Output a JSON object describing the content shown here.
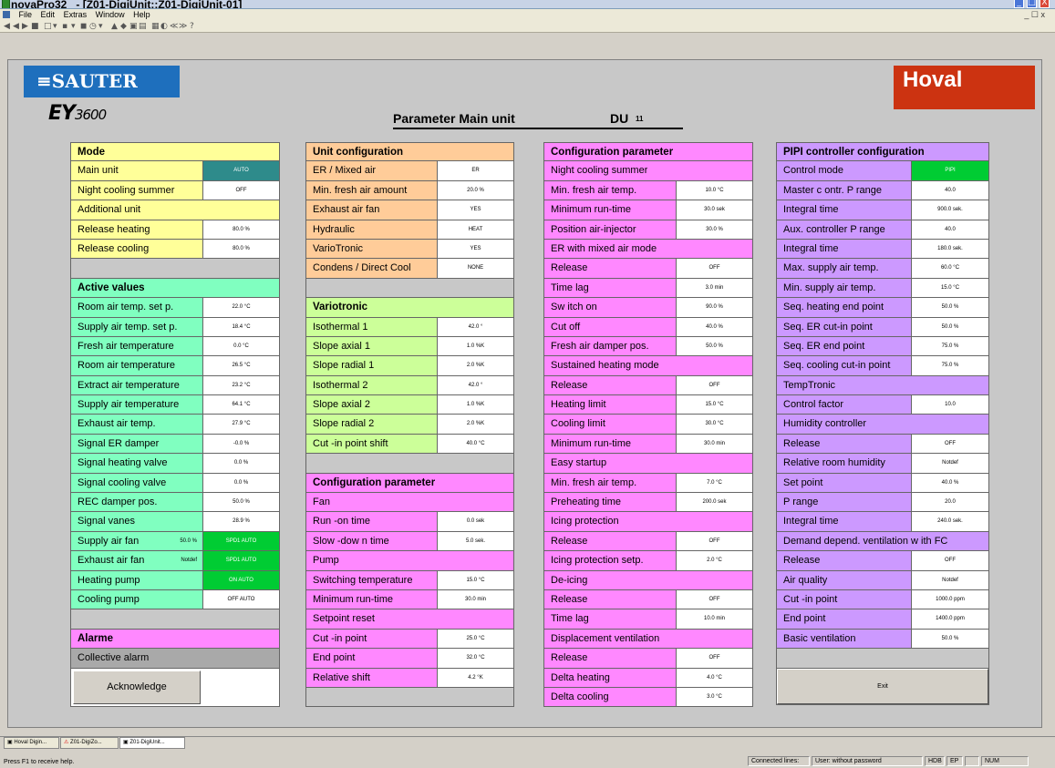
{
  "window": {
    "app_name": "novaPro32",
    "doc_title": "- [Z01-DigiUnit::Z01-DigiUnit-01]",
    "controls": [
      "_",
      "□",
      "X"
    ]
  },
  "menu": [
    "File",
    "Edit",
    "Extras",
    "Window",
    "Help"
  ],
  "mdi_controls": "_ ☐ x",
  "toolbar_glyphs": [
    "◀",
    "◀",
    "▶",
    "■",
    "□",
    "▾",
    "▪",
    "▾",
    "◼",
    "◷",
    "▾",
    "▲",
    "◆",
    "▣",
    "▤",
    "▦",
    "◐",
    "≪",
    "≫",
    "?"
  ],
  "header": {
    "brand_left": "SAUTER",
    "product": "EY",
    "product_suffix": "3600",
    "title": "Parameter Main unit",
    "du_label": "DU",
    "du_number": "11",
    "brand_right": "Hoval"
  },
  "colors": {
    "yellow": "#ffff99",
    "green": "#80ffc0",
    "orange": "#ffcc99",
    "lime": "#ccff99",
    "pink": "#ff88ff",
    "purple": "#cc99ff",
    "gray": "#a9a9a9",
    "teal_status": "#2e8b8b",
    "green_status": "#00cc33"
  },
  "col1": [
    {
      "kind": "header",
      "label": "Mode",
      "bg": "yellow"
    },
    {
      "kind": "item",
      "label": "Main unit",
      "value": "AUTO",
      "bg": "yellow",
      "valbg": "teal_status",
      "valcolor": "#ffffff"
    },
    {
      "kind": "item",
      "label": "Night cooling summer",
      "value": "OFF",
      "bg": "yellow"
    },
    {
      "kind": "section",
      "label": "Additional unit",
      "bg": "yellow"
    },
    {
      "kind": "item",
      "label": "Release heating",
      "value": "80.0 %",
      "bg": "yellow"
    },
    {
      "kind": "item",
      "label": "Release cooling",
      "value": "80.0 %",
      "bg": "yellow"
    },
    {
      "kind": "gap"
    },
    {
      "kind": "header",
      "label": "Active values",
      "bg": "green"
    },
    {
      "kind": "item",
      "label": "Room air temp. set p.",
      "value": "22.0 °C",
      "bg": "green"
    },
    {
      "kind": "item",
      "label": "Supply air temp. set p.",
      "value": "18.4 °C",
      "bg": "green"
    },
    {
      "kind": "item",
      "label": "Fresh air temperature",
      "value": "0.0 °C",
      "bg": "green"
    },
    {
      "kind": "item",
      "label": "Room air temperature",
      "value": "26.5 °C",
      "bg": "green"
    },
    {
      "kind": "item",
      "label": "Extract air temperature",
      "value": "23.2 °C",
      "bg": "green"
    },
    {
      "kind": "item",
      "label": "Supply air temperature",
      "value": "64.1 °C",
      "bg": "green"
    },
    {
      "kind": "item",
      "label": "Exhaust air temp.",
      "value": "27.9 °C",
      "bg": "green"
    },
    {
      "kind": "item",
      "label": "Signal ER damper",
      "value": "-0.0 %",
      "bg": "green"
    },
    {
      "kind": "item",
      "label": "Signal heating valve",
      "value": "0.0 %",
      "bg": "green"
    },
    {
      "kind": "item",
      "label": "Signal cooling valve",
      "value": "0.0 %",
      "bg": "green"
    },
    {
      "kind": "item",
      "label": "REC damper pos.",
      "value": "50.0 %",
      "bg": "green"
    },
    {
      "kind": "item",
      "label": "Signal vanes",
      "value": "28.9 %",
      "bg": "green"
    },
    {
      "kind": "item",
      "label": "Supply air fan",
      "sub": "50.0 %",
      "value": "SPD1 AUTO",
      "bg": "green",
      "valbg": "green_status",
      "valcolor": "#ffffff"
    },
    {
      "kind": "item",
      "label": "Exhaust air fan",
      "sub": "Notdef",
      "value": "SPD1 AUTO",
      "bg": "green",
      "valbg": "green_status",
      "valcolor": "#ffffff"
    },
    {
      "kind": "item",
      "label": "Heating pump",
      "value": "ON AUTO",
      "bg": "green",
      "valbg": "green_status",
      "valcolor": "#ffffff"
    },
    {
      "kind": "item",
      "label": "Cooling pump",
      "value": "OFF AUTO",
      "bg": "green"
    },
    {
      "kind": "gap"
    },
    {
      "kind": "header",
      "label": "Alarme",
      "bg": "pink"
    },
    {
      "kind": "section",
      "label": "Collective alarm",
      "bg": "gray"
    },
    {
      "kind": "ack",
      "label": "Acknowledge"
    }
  ],
  "col2": [
    {
      "kind": "header",
      "label": "Unit configuration",
      "bg": "orange"
    },
    {
      "kind": "item",
      "label": "ER / Mixed air",
      "value": "ER",
      "bg": "orange"
    },
    {
      "kind": "item",
      "label": "Min. fresh air amount",
      "value": "20.0 %",
      "bg": "orange"
    },
    {
      "kind": "item",
      "label": "Exhaust air fan",
      "value": "YES",
      "bg": "orange"
    },
    {
      "kind": "item",
      "label": "Hydraulic",
      "value": "HEAT",
      "bg": "orange"
    },
    {
      "kind": "item",
      "label": "VarioTronic",
      "value": "YES",
      "bg": "orange"
    },
    {
      "kind": "item",
      "label": "Condens / Direct Cool",
      "value": "NONE",
      "bg": "orange"
    },
    {
      "kind": "gap"
    },
    {
      "kind": "header",
      "label": "Variotronic",
      "bg": "lime"
    },
    {
      "kind": "item",
      "label": "Isothermal  1",
      "value": "42.0 °",
      "bg": "lime"
    },
    {
      "kind": "item",
      "label": "Slope axial  1",
      "value": "1.0 %K",
      "bg": "lime"
    },
    {
      "kind": "item",
      "label": "Slope radial  1",
      "value": "2.0 %K",
      "bg": "lime"
    },
    {
      "kind": "item",
      "label": "Isothermal  2",
      "value": "42.0 °",
      "bg": "lime"
    },
    {
      "kind": "item",
      "label": "Slope axial  2",
      "value": "1.0 %K",
      "bg": "lime"
    },
    {
      "kind": "item",
      "label": "Slope radial  2",
      "value": "2.0 %K",
      "bg": "lime"
    },
    {
      "kind": "item",
      "label": "Cut -in point shift",
      "value": "40.0 °C",
      "bg": "lime"
    },
    {
      "kind": "gap"
    },
    {
      "kind": "header",
      "label": "Configuration parameter",
      "bg": "pink"
    },
    {
      "kind": "section",
      "label": "Fan",
      "bg": "pink"
    },
    {
      "kind": "item",
      "label": "Run -on time",
      "value": "0.0 sek",
      "bg": "pink"
    },
    {
      "kind": "item",
      "label": "Slow -dow n time",
      "value": "5.0 sek.",
      "bg": "pink"
    },
    {
      "kind": "section",
      "label": "Pump",
      "bg": "pink"
    },
    {
      "kind": "item",
      "label": "Switching temperature",
      "value": "15.0 °C",
      "bg": "pink"
    },
    {
      "kind": "item",
      "label": "Minimum run-time",
      "value": "30.0 min",
      "bg": "pink"
    },
    {
      "kind": "section",
      "label": "Setpoint reset",
      "bg": "pink"
    },
    {
      "kind": "item",
      "label": "Cut -in point",
      "value": "25.0 °C",
      "bg": "pink"
    },
    {
      "kind": "item",
      "label": "End point",
      "value": "32.0 °C",
      "bg": "pink"
    },
    {
      "kind": "item",
      "label": "Relative shift",
      "value": "4.2 °K",
      "bg": "pink"
    },
    {
      "kind": "gap"
    }
  ],
  "col3": [
    {
      "kind": "header",
      "label": "Configuration parameter",
      "bg": "pink"
    },
    {
      "kind": "section",
      "label": "Night cooling summer",
      "bg": "pink"
    },
    {
      "kind": "item",
      "label": "Min. fresh air temp.",
      "value": "10.0 °C",
      "bg": "pink"
    },
    {
      "kind": "item",
      "label": "Minimum run-time",
      "value": "30.0 sek",
      "bg": "pink"
    },
    {
      "kind": "item",
      "label": "Position air-injector",
      "value": "30.0 %",
      "bg": "pink"
    },
    {
      "kind": "section",
      "label": "ER with mixed air mode",
      "bg": "pink"
    },
    {
      "kind": "item",
      "label": "Release",
      "value": "OFF",
      "bg": "pink"
    },
    {
      "kind": "item",
      "label": "Time lag",
      "value": "3.0 min",
      "bg": "pink"
    },
    {
      "kind": "item",
      "label": "Sw itch on",
      "value": "90.0 %",
      "bg": "pink"
    },
    {
      "kind": "item",
      "label": "Cut off",
      "value": "40.0 %",
      "bg": "pink"
    },
    {
      "kind": "item",
      "label": "Fresh air damper pos.",
      "value": "50.0 %",
      "bg": "pink"
    },
    {
      "kind": "section",
      "label": "Sustained heating mode",
      "bg": "pink"
    },
    {
      "kind": "item",
      "label": "Release",
      "value": "OFF",
      "bg": "pink"
    },
    {
      "kind": "item",
      "label": "Heating limit",
      "value": "15.0 °C",
      "bg": "pink"
    },
    {
      "kind": "item",
      "label": "Cooling limit",
      "value": "30.0 °C",
      "bg": "pink"
    },
    {
      "kind": "item",
      "label": "Minimum run-time",
      "value": "30.0 min",
      "bg": "pink"
    },
    {
      "kind": "section",
      "label": "Easy startup",
      "bg": "pink"
    },
    {
      "kind": "item",
      "label": "Min. fresh air temp.",
      "value": "7.0 °C",
      "bg": "pink"
    },
    {
      "kind": "item",
      "label": "Preheating time",
      "value": "200.0 sek",
      "bg": "pink"
    },
    {
      "kind": "section",
      "label": "Icing protection",
      "bg": "pink"
    },
    {
      "kind": "item",
      "label": "Release",
      "value": "OFF",
      "bg": "pink"
    },
    {
      "kind": "item",
      "label": "Icing protection setp.",
      "value": "2.0 °C",
      "bg": "pink"
    },
    {
      "kind": "section",
      "label": "De-icing",
      "bg": "pink"
    },
    {
      "kind": "item",
      "label": "Release",
      "value": "OFF",
      "bg": "pink"
    },
    {
      "kind": "item",
      "label": "Time lag",
      "value": "10.0 min",
      "bg": "pink"
    },
    {
      "kind": "section",
      "label": "Displacement ventilation",
      "bg": "pink"
    },
    {
      "kind": "item",
      "label": "Release",
      "value": "OFF",
      "bg": "pink"
    },
    {
      "kind": "item",
      "label": "Delta heating",
      "value": "4.0 °C",
      "bg": "pink"
    },
    {
      "kind": "item",
      "label": "Delta cooling",
      "value": "3.0 °C",
      "bg": "pink"
    }
  ],
  "col4": [
    {
      "kind": "header",
      "label": "PIPI controller configuration",
      "bg": "purple"
    },
    {
      "kind": "item",
      "label": "Control mode",
      "value": "PIPI",
      "bg": "purple",
      "valbg": "green_status",
      "valcolor": "#ffffff"
    },
    {
      "kind": "item",
      "label": "Master c ontr. P range",
      "value": "40.0",
      "bg": "purple"
    },
    {
      "kind": "item",
      "label": "Integral time",
      "value": "900.0 sek.",
      "bg": "purple"
    },
    {
      "kind": "item",
      "label": "Aux. controller P range",
      "value": "40.0",
      "bg": "purple"
    },
    {
      "kind": "item",
      "label": "Integral time",
      "value": "180.0 sek.",
      "bg": "purple"
    },
    {
      "kind": "item",
      "label": "Max. supply air temp.",
      "value": "60.0 °C",
      "bg": "purple"
    },
    {
      "kind": "item",
      "label": "Min. supply air temp.",
      "value": "15.0 °C",
      "bg": "purple"
    },
    {
      "kind": "item",
      "label": "Seq. heating end point",
      "value": "50.0 %",
      "bg": "purple"
    },
    {
      "kind": "item",
      "label": "Seq. ER cut-in point",
      "value": "50.0 %",
      "bg": "purple"
    },
    {
      "kind": "item",
      "label": "Seq. ER end point",
      "value": "75.0 %",
      "bg": "purple"
    },
    {
      "kind": "item",
      "label": "Seq. cooling cut-in point",
      "value": "75.0 %",
      "bg": "purple"
    },
    {
      "kind": "section",
      "label": "TempTronic",
      "bg": "purple"
    },
    {
      "kind": "item",
      "label": "Control factor",
      "value": "10.0",
      "bg": "purple"
    },
    {
      "kind": "section",
      "label": "Humidity controller",
      "bg": "purple"
    },
    {
      "kind": "item",
      "label": "Release",
      "value": "OFF",
      "bg": "purple"
    },
    {
      "kind": "item",
      "label": "Relative room humidity",
      "value": "Notdef",
      "bg": "purple"
    },
    {
      "kind": "item",
      "label": "Set point",
      "value": "40.0 %",
      "bg": "purple"
    },
    {
      "kind": "item",
      "label": "P range",
      "value": "20.0",
      "bg": "purple"
    },
    {
      "kind": "item",
      "label": "Integral time",
      "value": "240.0 sek.",
      "bg": "purple"
    },
    {
      "kind": "section",
      "label": "Demand depend. ventilation w ith FC",
      "bg": "purple"
    },
    {
      "kind": "item",
      "label": "Release",
      "value": "OFF",
      "bg": "purple"
    },
    {
      "kind": "item",
      "label": "Air quality",
      "value": "Notdef",
      "bg": "purple"
    },
    {
      "kind": "item",
      "label": "Cut -in point",
      "value": "1000.0 ppm",
      "bg": "purple"
    },
    {
      "kind": "item",
      "label": "End point",
      "value": "1400.0 ppm",
      "bg": "purple"
    },
    {
      "kind": "item",
      "label": "Basic ventilation",
      "value": "50.0 %",
      "bg": "purple"
    },
    {
      "kind": "gap"
    },
    {
      "kind": "exit",
      "label": "Exit"
    }
  ],
  "tabs": [
    {
      "label": "Hoval Digin...",
      "icon": "window-icon"
    },
    {
      "label": "Z01-DigiZo...",
      "icon": "warning-icon"
    },
    {
      "label": "Z01-DigiUnit...",
      "icon": "window-icon"
    }
  ],
  "status": {
    "help": "Press F1 to receive help.",
    "connected": "Connected lines:",
    "user": "User:  without password",
    "hdb": "HDB",
    "ep": "EP",
    "num": "NUM"
  }
}
